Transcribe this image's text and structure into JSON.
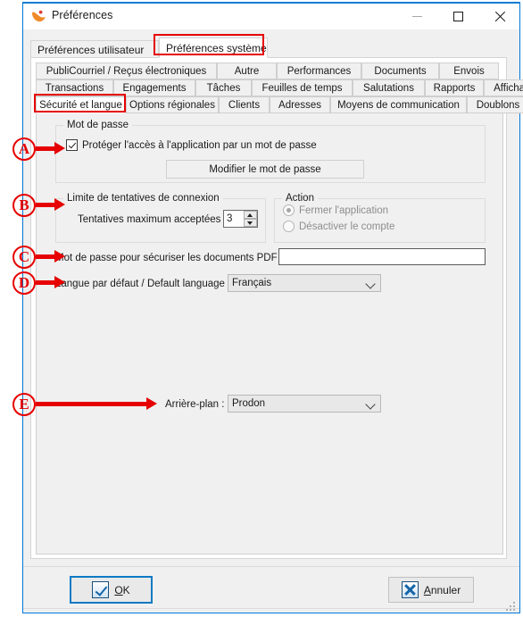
{
  "window": {
    "title": "Préférences",
    "icon": "app-bird-icon",
    "controls": {
      "minimize": "minimize-icon",
      "maximize": "maximize-icon",
      "close": "close-icon"
    }
  },
  "outer_tabs": [
    {
      "label": "Préférences utilisateur",
      "active": false
    },
    {
      "label": "Préférences système",
      "active": true
    }
  ],
  "inner_tabs": {
    "row1": [
      {
        "label": "PubliCourriel / Reçus électroniques",
        "active": false
      },
      {
        "label": "Autre",
        "active": false
      },
      {
        "label": "Performances",
        "active": false
      },
      {
        "label": "Documents",
        "active": false
      },
      {
        "label": "Envois",
        "active": false
      }
    ],
    "row2": [
      {
        "label": "Transactions",
        "active": false
      },
      {
        "label": "Engagements",
        "active": false
      },
      {
        "label": "Tâches",
        "active": false
      },
      {
        "label": "Feuilles de temps",
        "active": false
      },
      {
        "label": "Salutations",
        "active": false
      },
      {
        "label": "Rapports",
        "active": false
      },
      {
        "label": "Affichage",
        "active": false
      }
    ],
    "row3": [
      {
        "label": "Sécurité et langue",
        "active": true
      },
      {
        "label": "Options régionales",
        "active": false
      },
      {
        "label": "Clients",
        "active": false
      },
      {
        "label": "Adresses",
        "active": false
      },
      {
        "label": "Moyens de communication",
        "active": false
      },
      {
        "label": "Doublons",
        "active": false
      }
    ]
  },
  "password_group": {
    "title": "Mot de passe",
    "protect_checkbox": {
      "label": "Protéger l'accès à l'application par un mot de passe",
      "checked": true
    },
    "change_button": "Modifier le mot de passe"
  },
  "attempts_group": {
    "title": "Limite de tentatives de connexion",
    "max_attempts_label": "Tentatives maximum acceptées :",
    "max_attempts_value": "3"
  },
  "action_group": {
    "title": "Action",
    "options": [
      {
        "label": "Fermer l'application",
        "selected": true,
        "disabled": true
      },
      {
        "label": "Désactiver le compte",
        "selected": false,
        "disabled": true
      }
    ]
  },
  "pdf_password": {
    "label": "Mot de passe pour sécuriser les documents PDF :",
    "value": "",
    "placeholder": ""
  },
  "default_language": {
    "label": "Langue par défaut / Default language :",
    "value": "Français"
  },
  "background": {
    "label": "Arrière-plan :",
    "value": "Prodon"
  },
  "footer": {
    "ok": {
      "text_before": "",
      "mnemonic": "O",
      "text_after": "K",
      "label": "OK",
      "icon": "checkmark-icon"
    },
    "cancel": {
      "label": "Annuler",
      "mnemonic": "A",
      "text_after": "nnuler",
      "icon": "cross-icon"
    }
  },
  "annotations": [
    {
      "id": "A",
      "target": "protect-checkbox"
    },
    {
      "id": "B",
      "target": "attempts-group"
    },
    {
      "id": "C",
      "target": "pdf-password-field"
    },
    {
      "id": "D",
      "target": "default-language-combo"
    },
    {
      "id": "E",
      "target": "background-combo"
    }
  ],
  "colors": {
    "annotation": "#e60000",
    "accent": "#0078d7",
    "window_bg": "#f0f0f0"
  }
}
